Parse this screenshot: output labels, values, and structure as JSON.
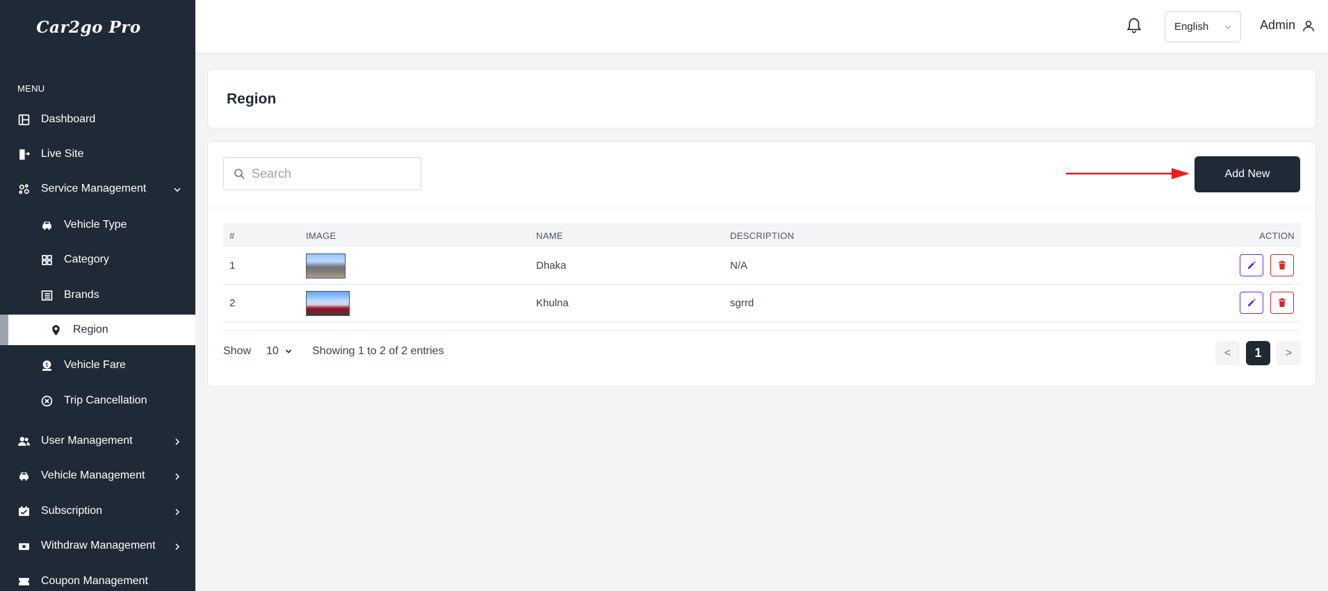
{
  "app": {
    "logo": "Car2go Pro"
  },
  "sidebar": {
    "menu_heading": "MENU",
    "items": [
      {
        "label": "Dashboard",
        "icon": "dashboard-icon"
      },
      {
        "label": "Live Site",
        "icon": "live-site-icon"
      },
      {
        "label": "Service Management",
        "icon": "service-icon",
        "expanded": true
      },
      {
        "label": "Vehicle Type",
        "icon": "car-icon"
      },
      {
        "label": "Category",
        "icon": "category-icon"
      },
      {
        "label": "Brands",
        "icon": "list-icon"
      },
      {
        "label": "Region",
        "icon": "map-pin-icon",
        "active": true
      },
      {
        "label": "Vehicle Fare",
        "icon": "fare-icon"
      },
      {
        "label": "Trip Cancellation",
        "icon": "cancel-circle-icon"
      },
      {
        "label": "User Management",
        "icon": "users-icon"
      },
      {
        "label": "Vehicle Management",
        "icon": "car-icon"
      },
      {
        "label": "Subscription",
        "icon": "subscription-icon"
      },
      {
        "label": "Withdraw Management",
        "icon": "withdraw-icon"
      },
      {
        "label": "Coupon Management",
        "icon": "coupon-icon"
      }
    ]
  },
  "topbar": {
    "language": "English",
    "user": "Admin"
  },
  "page": {
    "title": "Region",
    "search_placeholder": "Search",
    "add_button": "Add New"
  },
  "table": {
    "columns": [
      "#",
      "IMAGE",
      "NAME",
      "DESCRIPTION",
      "ACTION"
    ],
    "rows": [
      {
        "index": "1",
        "name": "Dhaka",
        "description": "N/A"
      },
      {
        "index": "2",
        "name": "Khulna",
        "description": "sgrrd"
      }
    ]
  },
  "footer": {
    "show_label": "Show",
    "page_size": "10",
    "entries_text": "Showing 1 to 2 of 2 entries",
    "prev": "<",
    "current_page": "1",
    "next": ">"
  },
  "colors": {
    "sidebar_bg": "#1f2a37",
    "accent": "#1f2a37",
    "edit": "#6d28d9",
    "delete": "#dc2626",
    "arrow": "#ee1c1c"
  }
}
